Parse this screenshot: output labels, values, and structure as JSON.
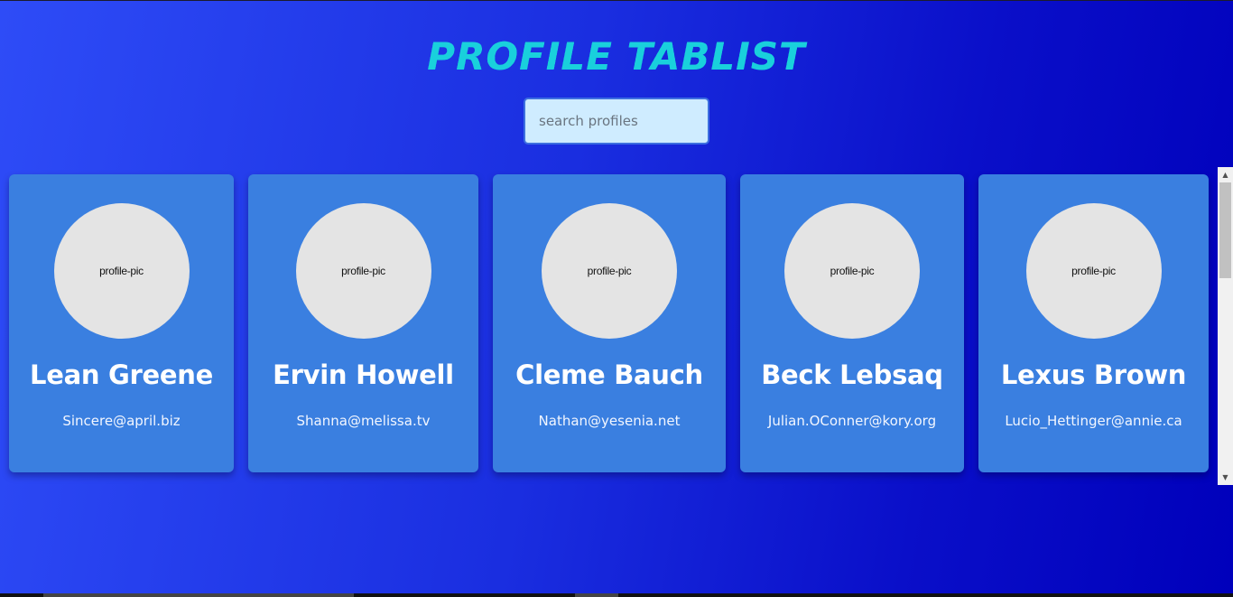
{
  "page": {
    "title": "PROFILE TABLIST"
  },
  "search": {
    "placeholder": "search profiles",
    "value": ""
  },
  "profiles": [
    {
      "pic_label": "profile-pic",
      "name": "Lean Greene",
      "email": "Sincere@april.biz"
    },
    {
      "pic_label": "profile-pic",
      "name": "Ervin Howell",
      "email": "Shanna@melissa.tv"
    },
    {
      "pic_label": "profile-pic",
      "name": "Cleme Bauch",
      "email": "Nathan@yesenia.net"
    },
    {
      "pic_label": "profile-pic",
      "name": "Beck Lebsaq",
      "email": "Julian.OConner@kory.org"
    },
    {
      "pic_label": "profile-pic",
      "name": "Lexus Brown",
      "email": "Lucio_Hettinger@annie.ca"
    }
  ],
  "colors": {
    "title": "#19d0dc",
    "card": "#3a7fe0",
    "search_bg": "#cfecff",
    "avatar": "#e4e4e4"
  },
  "icons": {
    "scroll_up": "triangle-up-icon",
    "scroll_down": "triangle-down-icon"
  }
}
